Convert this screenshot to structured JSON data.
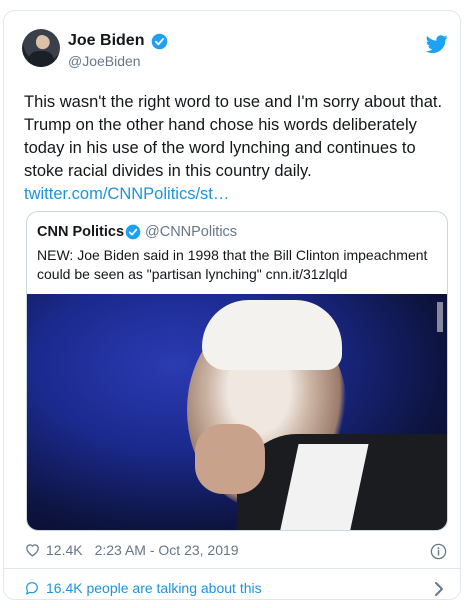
{
  "author": {
    "name": "Joe Biden",
    "handle": "@JoeBiden"
  },
  "tweet": {
    "text": "This wasn't the right word to use and I'm sorry about that. Trump on the other hand chose his words deliberately today in his use of the word lynching and continues to stoke racial divides in this country daily.",
    "link": "twitter.com/CNNPolitics/st…"
  },
  "quoted": {
    "name": "CNN Politics",
    "handle": "@CNNPolitics",
    "text": "NEW: Joe Biden said in 1998 that the Bill Clinton impeachment could be seen as \"partisan lynching\" cnn.it/31zlqld"
  },
  "meta": {
    "likes": "12.4K",
    "timestamp": "2:23 AM - Oct 23, 2019"
  },
  "footer": {
    "talking": "16.4K people are talking about this"
  },
  "icons": {
    "verified": "verified-badge-icon",
    "bird": "twitter-bird-icon",
    "heart": "heart-icon",
    "info": "info-icon",
    "bubble": "speech-bubble-icon",
    "chevron": "chevron-right-icon"
  },
  "colors": {
    "accent": "#1b95e0",
    "muted": "#657786",
    "text": "#14171a"
  }
}
